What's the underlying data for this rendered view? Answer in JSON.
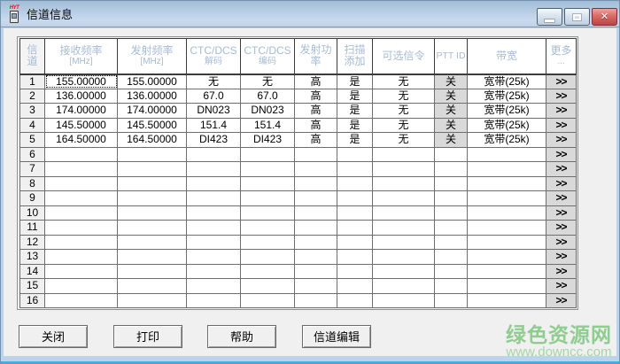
{
  "window": {
    "title": "信道信息",
    "icon_text": "HYT",
    "controls": {
      "minimize": "minimize",
      "maximize": "maximize",
      "close": "✕"
    }
  },
  "table": {
    "col_keys": [
      "ch",
      "rx",
      "tx",
      "dec",
      "enc",
      "power",
      "scan",
      "sig",
      "ptt",
      "bw",
      "more"
    ],
    "columns": [
      {
        "label": "信道",
        "sub": ""
      },
      {
        "label": "接收频率",
        "sub": "[MHz]"
      },
      {
        "label": "发射频率",
        "sub": "[MHz]"
      },
      {
        "label": "CTC/DCS",
        "sub": "解码"
      },
      {
        "label": "CTC/DCS",
        "sub": "编码"
      },
      {
        "label": "发射功率",
        "sub": ""
      },
      {
        "label": "扫描添加",
        "sub": ""
      },
      {
        "label": "可选信令",
        "sub": ""
      },
      {
        "label": "PTT ID",
        "sub": ""
      },
      {
        "label": "带宽",
        "sub": ""
      },
      {
        "label": "更多",
        "sub": "..."
      }
    ],
    "rows": [
      {
        "ch": "1",
        "rx": "155.00000",
        "tx": "155.00000",
        "dec": "无",
        "enc": "无",
        "power": "高",
        "scan": "是",
        "sig": "无",
        "ptt": "关",
        "bw": "宽带(25k)",
        "more": ">>"
      },
      {
        "ch": "2",
        "rx": "136.00000",
        "tx": "136.00000",
        "dec": "67.0",
        "enc": "67.0",
        "power": "高",
        "scan": "是",
        "sig": "无",
        "ptt": "关",
        "bw": "宽带(25k)",
        "more": ">>"
      },
      {
        "ch": "3",
        "rx": "174.00000",
        "tx": "174.00000",
        "dec": "DN023",
        "enc": "DN023",
        "power": "高",
        "scan": "是",
        "sig": "无",
        "ptt": "关",
        "bw": "宽带(25k)",
        "more": ">>"
      },
      {
        "ch": "4",
        "rx": "145.50000",
        "tx": "145.50000",
        "dec": "151.4",
        "enc": "151.4",
        "power": "高",
        "scan": "是",
        "sig": "无",
        "ptt": "关",
        "bw": "宽带(25k)",
        "more": ">>"
      },
      {
        "ch": "5",
        "rx": "164.50000",
        "tx": "164.50000",
        "dec": "DI423",
        "enc": "DI423",
        "power": "高",
        "scan": "是",
        "sig": "无",
        "ptt": "关",
        "bw": "宽带(25k)",
        "more": ">>"
      },
      {
        "ch": "6",
        "rx": "",
        "tx": "",
        "dec": "",
        "enc": "",
        "power": "",
        "scan": "",
        "sig": "",
        "ptt": "",
        "bw": "",
        "more": ">>"
      },
      {
        "ch": "7",
        "rx": "",
        "tx": "",
        "dec": "",
        "enc": "",
        "power": "",
        "scan": "",
        "sig": "",
        "ptt": "",
        "bw": "",
        "more": ">>"
      },
      {
        "ch": "8",
        "rx": "",
        "tx": "",
        "dec": "",
        "enc": "",
        "power": "",
        "scan": "",
        "sig": "",
        "ptt": "",
        "bw": "",
        "more": ">>"
      },
      {
        "ch": "9",
        "rx": "",
        "tx": "",
        "dec": "",
        "enc": "",
        "power": "",
        "scan": "",
        "sig": "",
        "ptt": "",
        "bw": "",
        "more": ">>"
      },
      {
        "ch": "10",
        "rx": "",
        "tx": "",
        "dec": "",
        "enc": "",
        "power": "",
        "scan": "",
        "sig": "",
        "ptt": "",
        "bw": "",
        "more": ">>"
      },
      {
        "ch": "11",
        "rx": "",
        "tx": "",
        "dec": "",
        "enc": "",
        "power": "",
        "scan": "",
        "sig": "",
        "ptt": "",
        "bw": "",
        "more": ">>"
      },
      {
        "ch": "12",
        "rx": "",
        "tx": "",
        "dec": "",
        "enc": "",
        "power": "",
        "scan": "",
        "sig": "",
        "ptt": "",
        "bw": "",
        "more": ">>"
      },
      {
        "ch": "13",
        "rx": "",
        "tx": "",
        "dec": "",
        "enc": "",
        "power": "",
        "scan": "",
        "sig": "",
        "ptt": "",
        "bw": "",
        "more": ">>"
      },
      {
        "ch": "14",
        "rx": "",
        "tx": "",
        "dec": "",
        "enc": "",
        "power": "",
        "scan": "",
        "sig": "",
        "ptt": "",
        "bw": "",
        "more": ">>"
      },
      {
        "ch": "15",
        "rx": "",
        "tx": "",
        "dec": "",
        "enc": "",
        "power": "",
        "scan": "",
        "sig": "",
        "ptt": "",
        "bw": "",
        "more": ">>"
      },
      {
        "ch": "16",
        "rx": "",
        "tx": "",
        "dec": "",
        "enc": "",
        "power": "",
        "scan": "",
        "sig": "",
        "ptt": "",
        "bw": "",
        "more": ">>"
      }
    ]
  },
  "buttons": [
    {
      "label": "关闭"
    },
    {
      "label": "打印"
    },
    {
      "label": "帮助"
    },
    {
      "label": "信道编辑"
    }
  ],
  "watermark": {
    "line1": "绿色资源网",
    "line2": "www.downcc.com"
  },
  "colors": {
    "header_text": "#a7bbd3",
    "more_arrow": "#d93030",
    "cell_gray": "#d9d9d9",
    "watermark_green": "#8fcd8f",
    "close_red": "#c0443e"
  }
}
